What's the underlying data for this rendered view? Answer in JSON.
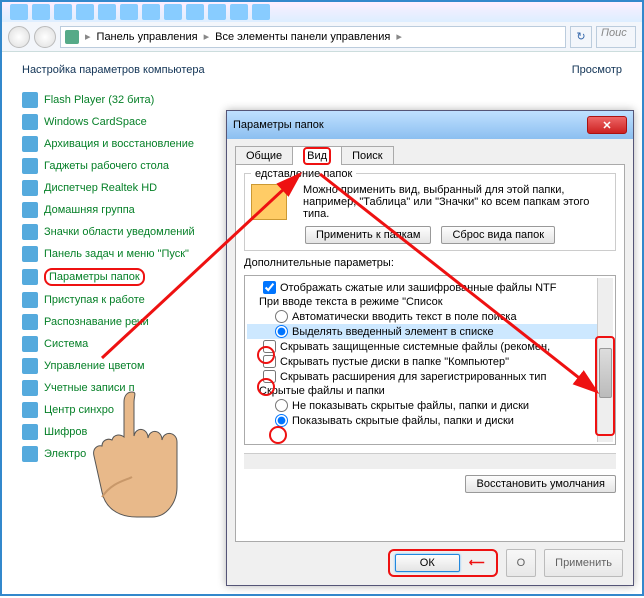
{
  "breadcrumb": {
    "a": "Панель управления",
    "b": "Все элементы панели управления",
    "triangle": "▸"
  },
  "search": "Поис",
  "cphead": "Настройка параметров компьютера",
  "cpview": "Просмотр",
  "items": [
    "Flash Player (32 бита)",
    "Windows CardSpace",
    "Архивация и восстановление",
    "Гаджеты рабочего стола",
    "Диспетчер Realtek HD",
    "Домашняя группа",
    "Значки области уведомлений",
    "Панель задач и меню \"Пуск\"",
    "Параметры папок",
    "Приступая к работе",
    "Распознавание речи",
    "Система",
    "Управление цветом",
    "Учетные записи п",
    "Центр синхро",
    "Шифров",
    "Электро"
  ],
  "dlg": {
    "title": "Параметры папок",
    "tabs": [
      "Общие",
      "Вид",
      "Поиск"
    ],
    "grp1": "едставление папок",
    "grp1txt": "Можно применить вид, выбранный для этой папки, например, \"Таблица\" или \"Значки\" ко всем папкам этого типа.",
    "applyBtn": "Применить к папкам",
    "resetBtn": "Сброс вида папок",
    "advlbl": "Дополнительные параметры:",
    "adv": [
      {
        "t": "chk",
        "c": true,
        "txt": "Отображать сжатые или зашифрованные файлы NTF"
      },
      {
        "t": "lbl",
        "txt": "При вводе текста в режиме \"Список"
      },
      {
        "t": "rad",
        "c": false,
        "txt": "Автоматически вводить текст в поле поиска"
      },
      {
        "t": "rad",
        "c": true,
        "txt": "Выделять введенный элемент в списке",
        "sel": true
      },
      {
        "t": "chk",
        "c": false,
        "txt": "Скрывать защищенные системные файлы (рекомен,",
        "ring": true
      },
      {
        "t": "chk",
        "c": false,
        "txt": "Скрывать пустые диски в папке \"Компьютер\""
      },
      {
        "t": "chk",
        "c": false,
        "txt": "Скрывать расширения для зарегистрированных тип",
        "ring": true
      },
      {
        "t": "lbl",
        "txt": "Скрытые файлы и папки"
      },
      {
        "t": "rad",
        "c": false,
        "txt": "Не показывать скрытые файлы, папки и диски"
      },
      {
        "t": "rad",
        "c": true,
        "txt": "Показывать скрытые файлы, папки и диски",
        "ring": true
      }
    ],
    "restore": "Восстановить умолчания",
    "ok": "ОК",
    "cancel": "О",
    "apply": "Применить"
  }
}
